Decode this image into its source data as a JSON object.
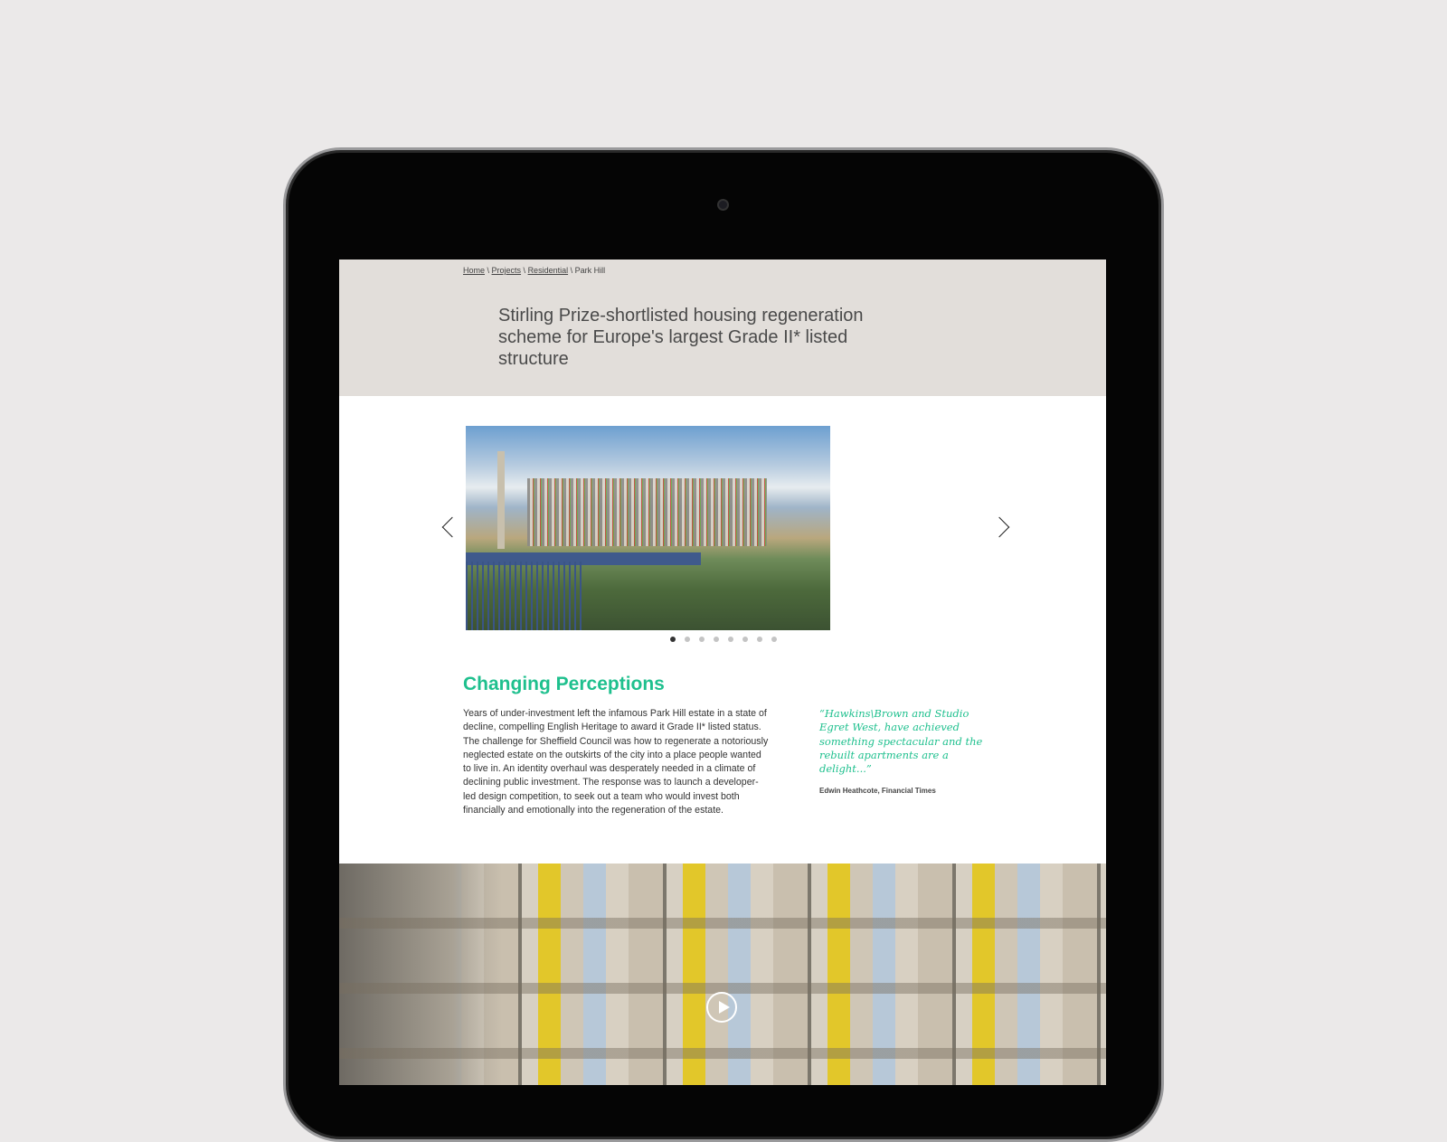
{
  "breadcrumb": {
    "items": [
      "Home",
      "Projects",
      "Residential"
    ],
    "current": "Park Hill",
    "separator": " \\ "
  },
  "hero": {
    "title": "Stirling Prize-shortlisted housing regeneration scheme for Europe's largest Grade II* listed structure"
  },
  "carousel": {
    "slide_count": 8,
    "active_index": 0,
    "prev_icon": "chevron-left-icon",
    "next_icon": "chevron-right-icon"
  },
  "section": {
    "heading": "Changing Perceptions",
    "body": "Years of under-investment left the infamous Park Hill estate in a state of decline, compelling English Heritage to award it Grade II* listed status. The challenge for Sheffield Council was how to regenerate a notoriously neglected estate on the outskirts of the city into a place people wanted to live in. An identity overhaul was desperately needed in a climate of declining public investment. The response was to launch a developer-led design competition, to seek out a team who would invest both financially and emotionally into the regeneration of the estate.",
    "quote": "“Hawkins\\Brown and Studio Egret West, have achieved something spectacular and the rebuilt apartments are a delight...”",
    "citation": "Edwin Heathcote, Financial Times"
  },
  "colors": {
    "accent": "#1fc08e",
    "hero_bg": "#e2deda"
  },
  "video": {
    "play_icon": "play-icon"
  }
}
